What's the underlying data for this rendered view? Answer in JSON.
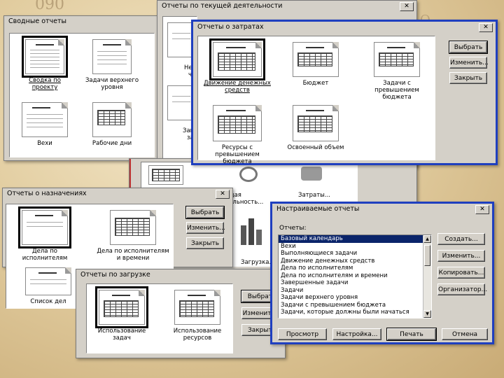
{
  "colors": {
    "accent_border": "#1f3fbf",
    "selection": "#0a246a"
  },
  "overview": {
    "title": "Сводные отчеты",
    "items": [
      {
        "label": "Сводка по проекту"
      },
      {
        "label": "Задачи верхнего уровня"
      },
      {
        "label": "Вехи"
      },
      {
        "label": "Рабочие дни"
      }
    ]
  },
  "current": {
    "title": "Отчеты по текущей деятельности",
    "partial_items": [
      "Не",
      "ч",
      "Заве",
      "за"
    ]
  },
  "costs": {
    "title": "Отчеты о затратах",
    "items": [
      {
        "label": "Движение денежных средств"
      },
      {
        "label": "Бюджет"
      },
      {
        "label": "Задачи с превышением бюджета"
      },
      {
        "label": "Ресурсы с превышением бюджета"
      },
      {
        "label": "Освоенный объем"
      }
    ],
    "buttons": {
      "select": "Выбрать",
      "edit": "Изменить...",
      "close": "Закрыть"
    }
  },
  "main_behind": {
    "labels": [
      "Текущая деятельность...",
      "Затраты...",
      "Загрузка..."
    ]
  },
  "assignments": {
    "title": "Отчеты о назначениях",
    "items": [
      {
        "label": "Дела по исполнителям"
      },
      {
        "label": "Дела по исполнителям и времени"
      },
      {
        "label": "Список дел"
      }
    ],
    "buttons": {
      "select": "Выбрать",
      "edit": "Изменить...",
      "close": "Закрыть"
    }
  },
  "workload": {
    "title": "Отчеты по загрузке",
    "items": [
      {
        "label": "Использование задач"
      },
      {
        "label": "Использование ресурсов"
      }
    ],
    "buttons": {
      "select": "Выбрать",
      "edit": "Изменить...",
      "close": "Закрыть"
    }
  },
  "custom": {
    "title": "Настраиваемые отчеты",
    "list_label": "Отчеты:",
    "items": [
      "Базовый календарь",
      "Вехи",
      "Выполняющиеся задачи",
      "Движение денежных средств",
      "Дела по исполнителям",
      "Дела по исполнителям и времени",
      "Завершенные задачи",
      "Задачи",
      "Задачи верхнего уровня",
      "Задачи с превышением бюджета",
      "Задачи, которые должны были начаться"
    ],
    "selected_index": 0,
    "side_buttons": {
      "create": "Создать...",
      "edit": "Изменить...",
      "copy": "Копировать...",
      "organizer": "Организатор..."
    },
    "bottom_buttons": {
      "preview": "Просмотр",
      "setup": "Настройка...",
      "print": "Печать",
      "cancel": "Отмена"
    }
  }
}
